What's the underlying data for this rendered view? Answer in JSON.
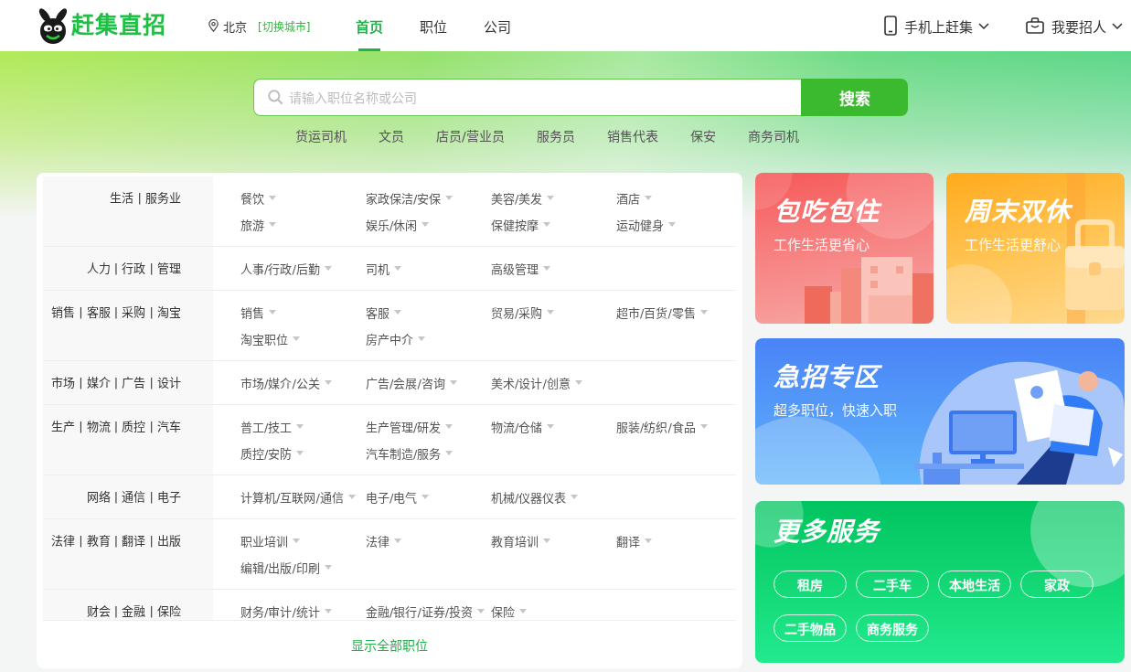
{
  "header": {
    "logo": {
      "text": "赶集直招"
    },
    "location": {
      "city": "北京",
      "switch_label": "[切换城市]"
    },
    "nav": [
      {
        "label": "首页",
        "selected": true
      },
      {
        "label": "职位",
        "selected": false
      },
      {
        "label": "公司",
        "selected": false
      }
    ],
    "actions": [
      {
        "kind": "phone",
        "label": "手机上赶集"
      },
      {
        "kind": "recruit",
        "label": "我要招人"
      }
    ]
  },
  "search": {
    "placeholder": "请输入职位名称或公司",
    "button": "搜索",
    "hot_keywords": [
      "货运司机",
      "文员",
      "店员/营业员",
      "服务员",
      "销售代表",
      "保安",
      "商务司机"
    ]
  },
  "categories": {
    "groups": [
      {
        "title": "生活 | 服务业",
        "items": [
          "餐饮",
          "家政保洁/安保",
          "美容/美发",
          "酒店",
          "旅游",
          "娱乐/休闲",
          "保健按摩",
          "运动健身"
        ]
      },
      {
        "title": "人力 | 行政 | 管理",
        "items": [
          "人事/行政/后勤",
          "司机",
          "高级管理"
        ]
      },
      {
        "title": "销售 | 客服 | 采购 | 淘宝",
        "items": [
          "销售",
          "客服",
          "贸易/采购",
          "超市/百货/零售",
          "淘宝职位",
          "房产中介"
        ]
      },
      {
        "title": "市场 | 媒介 | 广告 | 设计",
        "items": [
          "市场/媒介/公关",
          "广告/会展/咨询",
          "美术/设计/创意"
        ]
      },
      {
        "title": "生产 | 物流 | 质控 | 汽车",
        "items": [
          "普工/技工",
          "生产管理/研发",
          "物流/仓储",
          "服装/纺织/食品",
          "质控/安防",
          "汽车制造/服务"
        ]
      },
      {
        "title": "网络 | 通信 | 电子",
        "items": [
          "计算机/互联网/通信",
          "电子/电气",
          "机械/仪器仪表"
        ]
      },
      {
        "title": "法律 | 教育 | 翻译 | 出版",
        "items": [
          "职业培训",
          "法律",
          "教育培训",
          "翻译",
          "编辑/出版/印刷"
        ]
      },
      {
        "title": "财会 | 金融 | 保险",
        "items": [
          "财务/审计/统计",
          "金融/银行/证券/投资",
          "保险"
        ]
      }
    ],
    "show_all": "显示全部职位"
  },
  "promo_cards": [
    {
      "kind": "meals",
      "title": "包吃包住",
      "subtitle": "工作生活更省心"
    },
    {
      "kind": "weekend",
      "title": "周末双休",
      "subtitle": "工作生活更舒心"
    },
    {
      "kind": "urgent",
      "title": "急招专区",
      "subtitle": "超多职位，快速入职"
    }
  ],
  "more_services": {
    "title": "更多服务",
    "items": [
      "租房",
      "二手车",
      "本地生活",
      "家政",
      "二手物品",
      "商务服务"
    ]
  }
}
